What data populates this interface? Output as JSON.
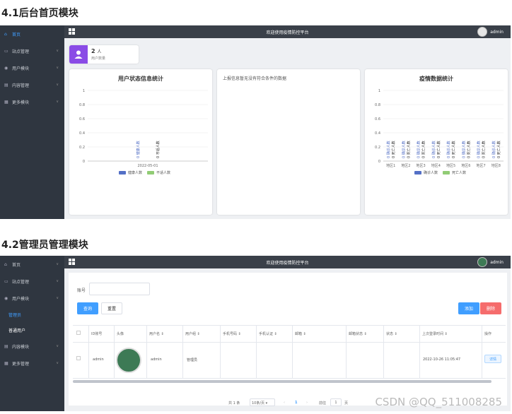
{
  "section1": {
    "title": "4.1后台首页模块"
  },
  "section2": {
    "title": "4.2管理员管理模块"
  },
  "header": {
    "title": "欢迎使用疫情防控平台",
    "username": "admin"
  },
  "sidebar1": {
    "items": [
      {
        "label": "首页",
        "icon": "home-icon",
        "active": true
      },
      {
        "label": "站点管理",
        "icon": "monitor-icon"
      },
      {
        "label": "用户模块",
        "icon": "user-icon"
      },
      {
        "label": "内容管理",
        "icon": "document-icon"
      },
      {
        "label": "更多模块",
        "icon": "grid-icon"
      }
    ]
  },
  "sidebar2": {
    "items": [
      {
        "label": "首页",
        "icon": "home-icon"
      },
      {
        "label": "站点管理",
        "icon": "monitor-icon"
      },
      {
        "label": "用户模块",
        "icon": "user-icon"
      }
    ],
    "sub": [
      {
        "label": "管理员",
        "active": true
      },
      {
        "label": "普通用户"
      }
    ],
    "items_after": [
      {
        "label": "内容模块",
        "icon": "document-icon"
      },
      {
        "label": "更多管理",
        "icon": "grid-icon"
      }
    ]
  },
  "stat": {
    "count": "2",
    "unit": "人",
    "label": "用户数量"
  },
  "card_user": {
    "title": "用户状态信息统计",
    "category": "2022-05-01",
    "legend": [
      "健康人数",
      "不适人数"
    ],
    "bar_labels": [
      "0 健康人数",
      "0 不适人数"
    ]
  },
  "card_report": {
    "text": "上报信息暂无没有符合条件的数据"
  },
  "card_epi": {
    "title": "疫情数据统计",
    "legend": [
      "确诊人数",
      "死亡人数"
    ],
    "bar_label": "0 确诊人数"
  },
  "admin": {
    "search_label": "账号",
    "search_placeholder": "",
    "btn_query": "查询",
    "btn_reset": "重置",
    "btn_add": "添加",
    "btn_delete": "删除",
    "columns": [
      "ID账号",
      "头像",
      "用户名 ⇕",
      "用户组 ⇕",
      "手机号码 ⇕",
      "手机认证 ⇕",
      "邮箱 ⇕",
      "邮箱状态 ⇕",
      "状态 ⇕",
      "上次登录时间 ⇕",
      "操作"
    ],
    "row": {
      "account": "admin",
      "username": "admin",
      "group": "管理员",
      "last_login": "2022-10-26 11:05:47",
      "action": "详情"
    },
    "pagination": {
      "total": "共 1 条",
      "size": "10条/页",
      "page": "1",
      "goto": "前往",
      "goto_page": "1",
      "unit": "页"
    }
  },
  "watermark": "CSDN @QQ_511008285",
  "chart_data": [
    {
      "type": "bar",
      "title": "用户状态信息统计",
      "categories": [
        "2022-05-01"
      ],
      "series": [
        {
          "name": "健康人数",
          "values": [
            0
          ]
        },
        {
          "name": "不适人数",
          "values": [
            0
          ]
        }
      ],
      "yticks": [
        "0",
        "0.2",
        "0.4",
        "0.6",
        "0.8",
        "1"
      ],
      "ylim": [
        0,
        1
      ]
    },
    {
      "type": "bar",
      "title": "疫情数据统计",
      "categories": [
        "地区1",
        "地区2",
        "地区3",
        "地区4",
        "地区5",
        "地区6",
        "地区7",
        "地区8"
      ],
      "series": [
        {
          "name": "确诊人数",
          "values": [
            0,
            0,
            0,
            0,
            0,
            0,
            0,
            0
          ]
        },
        {
          "name": "死亡人数",
          "values": [
            0,
            0,
            0,
            0,
            0,
            0,
            0,
            0
          ]
        }
      ],
      "yticks": [
        "0",
        "0.2",
        "0.4",
        "0.6",
        "0.8",
        "1"
      ],
      "ylim": [
        0,
        1
      ]
    }
  ]
}
